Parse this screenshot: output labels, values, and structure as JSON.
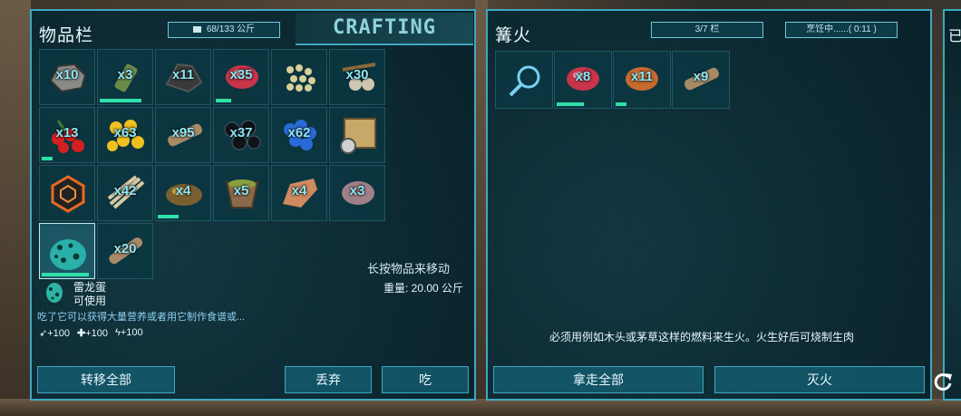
{
  "inventory": {
    "title": "物品栏",
    "weight_capacity": "68/133 公斤",
    "crafting_tab": "CRAFTING",
    "slots": [
      {
        "item": "stone",
        "qty": "x10",
        "durability": 0
      },
      {
        "item": "flint",
        "qty": "x3",
        "durability": 0.8
      },
      {
        "item": "wood-chunks",
        "qty": "x11",
        "durability": 0
      },
      {
        "item": "raw-meat",
        "qty": "x35",
        "durability": 0.3
      },
      {
        "item": "seeds",
        "qty": "",
        "durability": 0
      },
      {
        "item": "bola-stones",
        "qty": "x30",
        "durability": 0
      },
      {
        "item": "red-berries",
        "qty": "x13",
        "durability": 0.2
      },
      {
        "item": "yellow-berries",
        "qty": "x63",
        "durability": 0
      },
      {
        "item": "wood-log",
        "qty": "x95",
        "durability": 0
      },
      {
        "item": "black-berries",
        "qty": "x37",
        "durability": 0
      },
      {
        "item": "blue-berries",
        "qty": "x62",
        "durability": 0
      },
      {
        "item": "map-compass",
        "qty": "",
        "durability": 0
      },
      {
        "item": "hex-charm",
        "qty": "",
        "durability": 0
      },
      {
        "item": "thatch",
        "qty": "x42",
        "durability": 0
      },
      {
        "item": "cooked-meat-pile",
        "qty": "x4",
        "durability": 0.4
      },
      {
        "item": "waterskin",
        "qty": "x5",
        "durability": 0
      },
      {
        "item": "hide",
        "qty": "x4",
        "durability": 0
      },
      {
        "item": "oil-stone",
        "qty": "x3",
        "durability": 0
      },
      {
        "item": "dodo-egg",
        "qty": "",
        "durability": 0.9,
        "selected": true
      },
      {
        "item": "wood-log-2",
        "qty": "x20",
        "durability": 0
      }
    ],
    "hint": "长按物品来移动",
    "selected_name": "雷龙蛋",
    "selected_status": "可使用",
    "selected_weight": "重量: 20.00 公斤",
    "selected_desc": "吃了它可以获得大量营养或者用它制作食谱或...",
    "stats": {
      "food": "+100",
      "health": "+100",
      "stamina": "+100"
    },
    "btn_transfer_all": "转移全部",
    "btn_drop": "丢弃",
    "btn_eat": "吃"
  },
  "campfire": {
    "title": "篝火",
    "slots_count": "3/7 栏",
    "cooking_status": "烹饪中......( 0:11 )",
    "slots": [
      {
        "item": "search",
        "qty": ""
      },
      {
        "item": "raw-meat",
        "qty": "x8"
      },
      {
        "item": "cooked-meat",
        "qty": "x11"
      },
      {
        "item": "wood-log",
        "qty": "x9"
      }
    ],
    "message": "必须用例如木头或茅草这样的燃料来生火。火生好后可烧制生肉",
    "btn_take_all": "拿走全部",
    "btn_extinguish": "灭火",
    "next_panel_initial": "已"
  }
}
